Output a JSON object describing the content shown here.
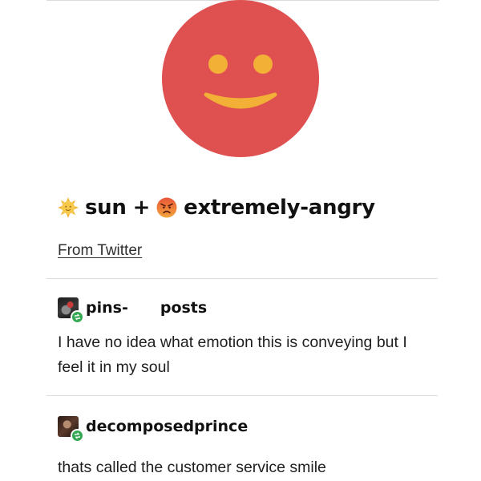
{
  "post": {
    "image": {
      "icon": "red-smiley-face-icon",
      "face_color": "#df5150",
      "feature_color": "#f3b037"
    },
    "emoji_combo": {
      "first_icon": "sun-emoji-icon",
      "first_label": "sun",
      "operator": "+",
      "second_icon": "extremely-angry-emoji-icon",
      "second_label": "extremely-angry"
    },
    "source_link": "From Twitter"
  },
  "reblogs": [
    {
      "avatar_icon": "user-avatar-icon",
      "badge_icon": "reblog-icon",
      "badge_color": "#35a853",
      "username": "pins-",
      "username_suffix": "posts",
      "body": "I have no idea what emotion this is conveying but I feel it in my soul"
    },
    {
      "avatar_icon": "user-avatar-icon",
      "badge_icon": "reblog-icon",
      "badge_color": "#35a853",
      "username": "decomposedprince",
      "body": "thats called the customer service smile"
    }
  ]
}
